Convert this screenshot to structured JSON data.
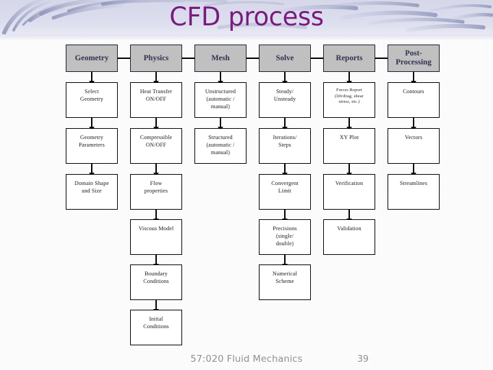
{
  "slide": {
    "title": "CFD process",
    "title_color": "#7a1b7e",
    "background_color": "#ffffff",
    "banner_color": "#d8daea"
  },
  "diagram": {
    "header_fill": "#c0c0c0",
    "header_text_color": "#313152",
    "node_fill": "#ffffff",
    "node_border_color": "#000000",
    "columns": [
      {
        "key": "geometry",
        "header": "Geometry",
        "steps": [
          "Select\nGeometry",
          "Geometry\nParameters",
          "Domain Shape\nand Size"
        ]
      },
      {
        "key": "physics",
        "header": "Physics",
        "steps": [
          "Heat Transfer\nON/OFF",
          "Compressible\nON/OFF",
          "Flow\nproperties",
          "Viscous Model",
          "Boundary\nConditions",
          "Initial\nConditions"
        ]
      },
      {
        "key": "mesh",
        "header": "Mesh",
        "steps": [
          "Unstructured\n(automatic /\nmanual)",
          "Structured\n(automatic /\nmanual)"
        ]
      },
      {
        "key": "solve",
        "header": "Solve",
        "steps": [
          "Steady/\nUnsteady",
          "Iterations/\nSteps",
          "Convergent\nLimit",
          "Precisions\n(single/\ndouble)",
          "Numerical\nScheme"
        ]
      },
      {
        "key": "reports",
        "header": "Reports",
        "steps": [
          "Forces Report\n(lift/drag, shear\nstress, etc.)",
          "XY Plot",
          "Verification",
          "Validation"
        ]
      },
      {
        "key": "post-processing",
        "header": "Post-\nProcessing",
        "steps": [
          "Contours",
          "Vectors",
          "Streamlines"
        ]
      }
    ]
  },
  "footer": {
    "course": "57:020 Fluid Mechanics",
    "page_number": "39"
  }
}
